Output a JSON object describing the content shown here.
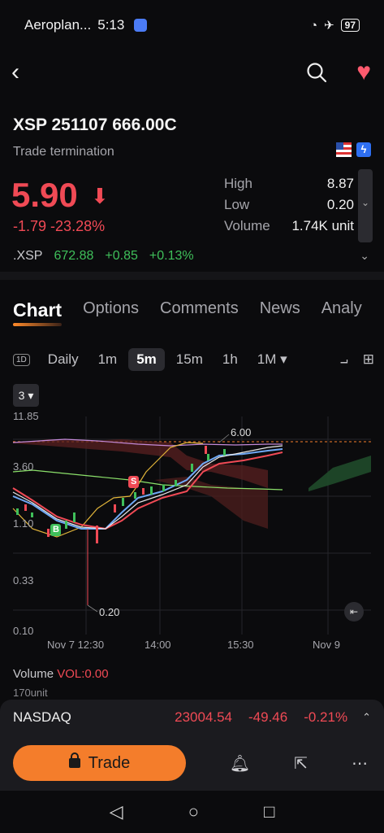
{
  "status_bar": {
    "app": "Aeroplan...",
    "time": "5:13",
    "battery": "97"
  },
  "contract": {
    "title": "XSP 251107 666.00C",
    "subtitle": "Trade termination"
  },
  "quote": {
    "price": "5.90",
    "change": "-1.79",
    "change_pct": "-23.28%",
    "high_label": "High",
    "high": "8.87",
    "low_label": "Low",
    "low": "0.20",
    "volume_label": "Volume",
    "volume": "1.74K unit"
  },
  "underlying": {
    "symbol": ".XSP",
    "price": "672.88",
    "change": "+0.85",
    "change_pct": "+0.13%"
  },
  "tabs": [
    "Chart",
    "Options",
    "Comments",
    "News",
    "Analy"
  ],
  "intervals": {
    "d1_icon": "1D",
    "daily": "Daily",
    "m1": "1m",
    "m5": "5m",
    "m15": "15m",
    "h1": "1h",
    "month": "1M ▾"
  },
  "indicator_count": "3 ▾",
  "chart_data": {
    "type": "line",
    "y_ticks": [
      "11.85",
      "3.60",
      "1.10",
      "0.33",
      "0.10"
    ],
    "x_ticks": [
      "Nov 7 12:30",
      "14:00",
      "15:30",
      "Nov 9"
    ],
    "annotations": {
      "high": "6.00",
      "low": "0.20",
      "buy": "B",
      "sell": "S"
    },
    "scale": "log",
    "ylim": [
      0.1,
      11.85
    ]
  },
  "volume": {
    "label": "Volume",
    "indicator": "VOL:0.00",
    "unit_tick": "170unit"
  },
  "ticker": {
    "name": "NASDAQ",
    "value": "23004.54",
    "change": "-49.46",
    "change_pct": "-0.21%"
  },
  "actions": {
    "trade_label": "Trade"
  },
  "colors": {
    "accent": "#f47d2b",
    "down": "#f04a55",
    "up": "#3fbf5a"
  }
}
